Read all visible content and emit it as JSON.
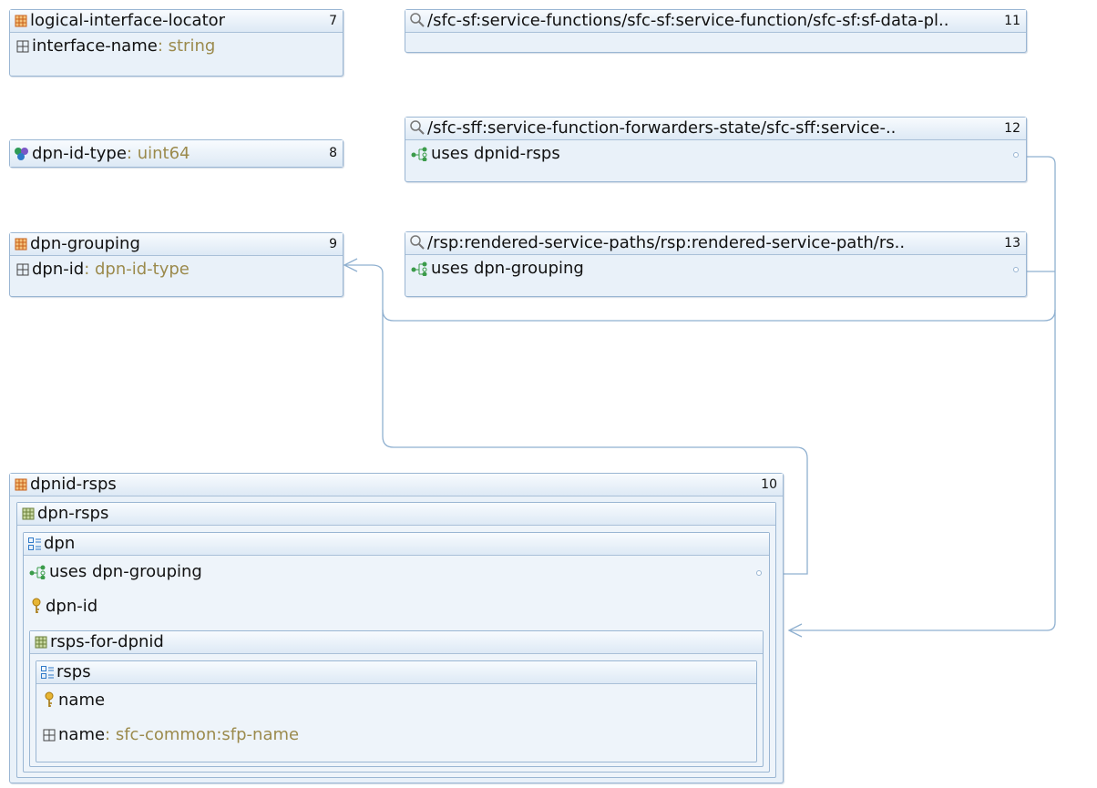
{
  "boxes": {
    "b7": {
      "name": "logical-interface-locator",
      "num": "7",
      "rows": [
        {
          "name": "interface-name",
          "sep": ": ",
          "type": "string"
        }
      ]
    },
    "b8": {
      "name": "dpn-id-type",
      "sep": ": ",
      "type": "uint64",
      "num": "8"
    },
    "b9": {
      "name": "dpn-grouping",
      "num": "9",
      "rows": [
        {
          "name": "dpn-id",
          "sep": ": ",
          "type": "dpn-id-type"
        }
      ]
    },
    "b11": {
      "name": "/sfc-sf:service-functions/sfc-sf:service-function/sfc-sf:sf-data-pl..",
      "num": "11"
    },
    "b12": {
      "name": "/sfc-sff:service-function-forwarders-state/sfc-sff:service-..",
      "num": "12",
      "rows": [
        {
          "name": "uses dpnid-rsps"
        }
      ]
    },
    "b13": {
      "name": "/rsp:rendered-service-paths/rsp:rendered-service-path/rs..",
      "num": "13",
      "rows": [
        {
          "name": "uses dpn-grouping"
        }
      ]
    },
    "b10": {
      "name": "dpnid-rsps",
      "num": "10",
      "dpn_rsps": "dpn-rsps",
      "dpn": "dpn",
      "uses": "uses dpn-grouping",
      "dpn_id": "dpn-id",
      "rsps_for_dpnid": "rsps-for-dpnid",
      "rsps": "rsps",
      "rsps_key": "name",
      "rsps_leaf": {
        "name": "name",
        "sep": ": ",
        "type": "sfc-common:sfp-name"
      }
    }
  },
  "colors": {
    "border": "#9ab6d3",
    "type": "#9b8a4c",
    "wire": "#8fb0d0"
  },
  "icons": [
    "grouping-icon",
    "leaf-icon",
    "typedef-icon",
    "search-icon",
    "uses-icon",
    "container-icon",
    "list-icon",
    "key-icon"
  ]
}
